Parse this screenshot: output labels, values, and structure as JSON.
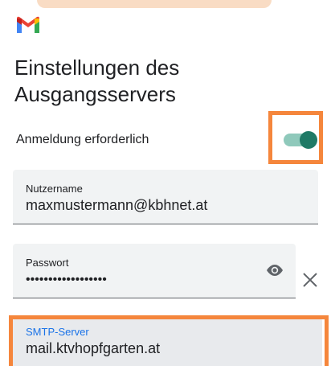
{
  "header": {
    "logo_icon": "gmail-logo-icon"
  },
  "page": {
    "title": "Einstellungen des Ausgangsservers"
  },
  "login_required": {
    "label": "Anmeldung erforderlich",
    "enabled": true
  },
  "username": {
    "label": "Nutzername",
    "value": "maxmustermann@kbhnet.at"
  },
  "password": {
    "label": "Passwort",
    "value": "••••••••••••••••••",
    "visibility_icon": "eye-icon",
    "clear_icon": "close-icon"
  },
  "smtp": {
    "label": "SMTP-Server",
    "value": "mail.ktvhopfgarten.at"
  },
  "colors": {
    "highlight": "#f5863c",
    "toggle_on": "#1f7a66",
    "focus_label": "#1a73e8"
  }
}
